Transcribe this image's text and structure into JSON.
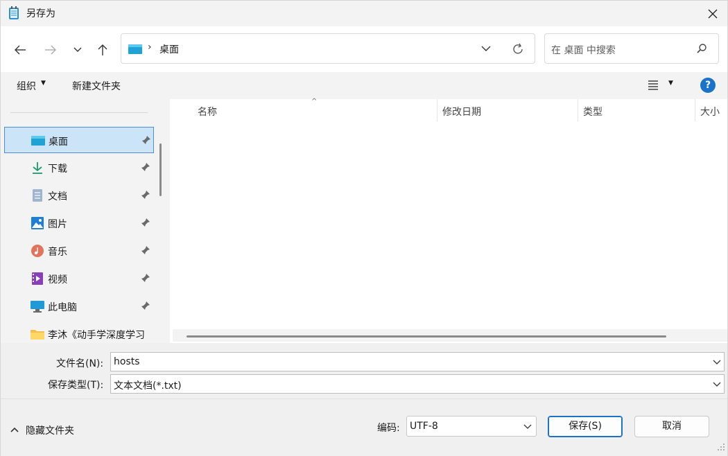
{
  "window": {
    "title": "另存为"
  },
  "nav": {
    "breadcrumb_current": "桌面",
    "breadcrumb_separator": "›",
    "search_placeholder": "在 桌面 中搜索"
  },
  "toolbar": {
    "organize_label": "组织",
    "new_folder_label": "新建文件夹",
    "help_label": "?"
  },
  "sidebar": {
    "items": [
      {
        "label": "桌面",
        "icon": "desktop-icon",
        "selected": true
      },
      {
        "label": "下载",
        "icon": "download-icon"
      },
      {
        "label": "文档",
        "icon": "document-icon"
      },
      {
        "label": "图片",
        "icon": "pictures-icon"
      },
      {
        "label": "音乐",
        "icon": "music-icon"
      },
      {
        "label": "视频",
        "icon": "video-icon"
      },
      {
        "label": "此电脑",
        "icon": "computer-icon"
      },
      {
        "label": "李沐《动手学深度学习",
        "icon": "folder-icon"
      }
    ]
  },
  "columns": {
    "name": "名称",
    "modified": "修改日期",
    "type": "类型",
    "size": "大小"
  },
  "form": {
    "filename_label": "文件名(N):",
    "filename_value": "hosts",
    "filetype_label": "保存类型(T):",
    "filetype_value": "文本文档(*.txt)",
    "hide_folders_label": "隐藏文件夹",
    "encoding_label": "编码:",
    "encoding_value": "UTF-8",
    "save_label": "保存(S)",
    "cancel_label": "取消"
  },
  "colors": {
    "accent": "#1a73c9",
    "selection_bg": "#cce4f7"
  }
}
